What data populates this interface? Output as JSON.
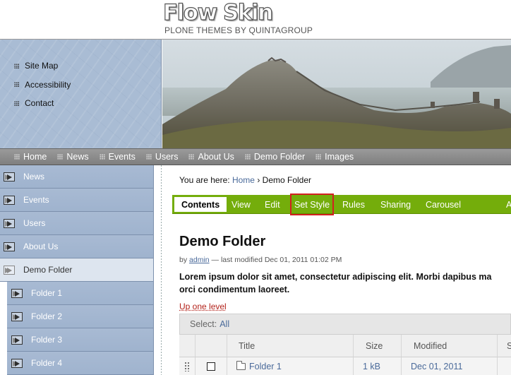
{
  "logo": {
    "title": "Flow Skin",
    "subtitle": "PLONE THEMES BY QUINTAGROUP"
  },
  "site_actions": [
    "Site Map",
    "Accessibility",
    "Contact"
  ],
  "global_nav": [
    "Home",
    "News",
    "Events",
    "Users",
    "About Us",
    "Demo Folder",
    "Images"
  ],
  "left_nav": {
    "top_items": [
      "News",
      "Events",
      "Users",
      "About Us"
    ],
    "selected": "Demo Folder",
    "sub_items": [
      "Folder 1",
      "Folder 2",
      "Folder 3",
      "Folder 4"
    ]
  },
  "breadcrumb": {
    "prefix": "You are here:",
    "home": "Home",
    "separator": "›",
    "current": "Demo Folder"
  },
  "action_tabs": [
    "Contents",
    "View",
    "Edit",
    "Set Style",
    "Rules",
    "Sharing",
    "Carousel",
    "A"
  ],
  "active_tab": "Contents",
  "highlighted_tab": "Set Style",
  "document": {
    "title": "Demo Folder",
    "byline_prefix": "by",
    "author": "admin",
    "byline_suffix": "— last modified Dec 01, 2011 01:02 PM",
    "description_line1": "Lorem ipsum dolor sit amet, consectetur adipiscing elit. Morbi dapibus ma",
    "description_line2": "orci condimentum laoreet."
  },
  "up_one_level": "Up one level",
  "select": {
    "label": "Select:",
    "all": "All"
  },
  "table": {
    "headers": [
      "Title",
      "Size",
      "Modified",
      "S"
    ],
    "rows": [
      {
        "title": "Folder 1",
        "size": "1 kB",
        "modified": "Dec 01, 2011"
      }
    ]
  },
  "colors": {
    "action_bar": "#74ad0b",
    "highlight_outline": "#d32020",
    "left_nav": "#a8bad3"
  }
}
